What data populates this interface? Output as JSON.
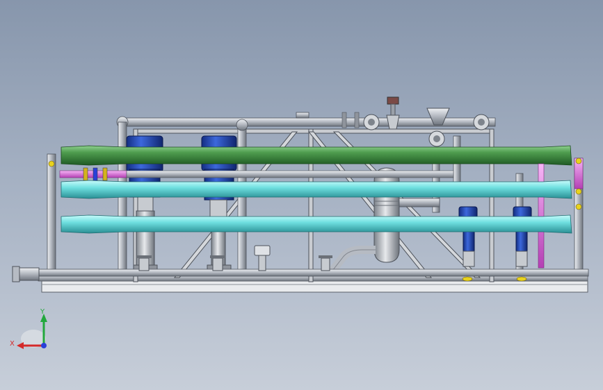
{
  "viewport": {
    "background_top": "#8796ac",
    "background_bottom": "#c7ced9"
  },
  "triad": {
    "x_label": "X",
    "y_label": "Y",
    "x_color": "#d42a2a",
    "y_color": "#22a83c",
    "z_color": "#2a40d8"
  },
  "colors": {
    "feed_pipe": "#4e9c4e",
    "membrane_vessel": "#6fe0e0",
    "pump_motor": "#1f47b8",
    "frame": "#9ea3ab",
    "pink_line": "#e070e0",
    "valve_yellow": "#e8d21e"
  },
  "icons": {
    "triad": "coordinate-triad-icon"
  }
}
